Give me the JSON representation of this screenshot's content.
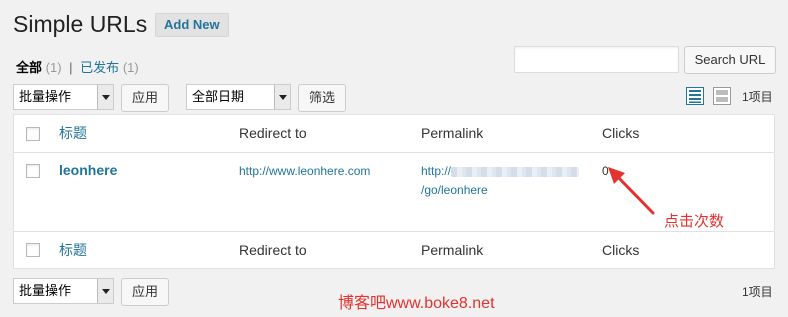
{
  "header": {
    "title": "Simple URLs",
    "add_new": "Add New"
  },
  "filters": {
    "all_label": "全部",
    "all_count": "(1)",
    "separator": "|",
    "published_label": "已发布",
    "published_count": "(1)"
  },
  "search": {
    "value": "",
    "button": "Search URL"
  },
  "top_nav": {
    "bulk_select": "批量操作",
    "apply": "应用",
    "date_select": "全部日期",
    "filter": "筛选",
    "items_count": "1项目"
  },
  "table": {
    "columns": [
      "标题",
      "Redirect to",
      "Permalink",
      "Clicks"
    ],
    "rows": [
      {
        "title": "leonhere",
        "redirect": "http://www.leonhere.com",
        "permalink_prefix": "http://",
        "permalink_suffix": "/go/leonhere",
        "clicks": "0"
      }
    ]
  },
  "bottom_nav": {
    "bulk_select": "批量操作",
    "apply": "应用",
    "items_count": "1项目"
  },
  "annotation": {
    "text": "点击次数",
    "color": "#e4322e"
  },
  "watermark": {
    "text": "博客吧www.boke8.net"
  },
  "colors": {
    "link": "#21759b",
    "accent_red": "#e4322e",
    "background": "#f1f1f1"
  },
  "icons": {
    "list_view": "list-view-icon",
    "excerpt_view": "excerpt-view-icon"
  }
}
